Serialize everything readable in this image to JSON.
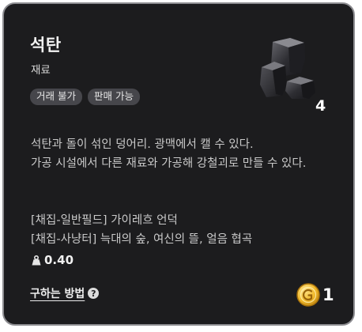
{
  "item": {
    "name": "석탄",
    "category": "재료",
    "tags": [
      "거래 불가",
      "판매 가능"
    ],
    "image_icon": "coal-lumps-icon",
    "quantity": "4",
    "description": [
      "석탄과 돌이 섞인 덩어리. 광맥에서 캘 수 있다.",
      "가공 시설에서 다른 재료와 가공해 강철괴로 만들 수 있다."
    ],
    "sources": [
      "[채집-일반필드] 가이레흐 언덕",
      "[채집-사냥터] 늑대의 숲, 여신의 뜰, 얼음 협곡"
    ],
    "weight": "0.40",
    "weight_icon": "weight-icon"
  },
  "footer": {
    "how_to_obtain_label": "구하는 방법",
    "help_icon": "question-icon",
    "price": "1",
    "currency_icon": "gold-coin-icon"
  },
  "colors": {
    "panel_background": "#1c1c1e",
    "panel_border": "#8d8d91",
    "tag_background": "#46464b",
    "coin_gold": "#f0b82a"
  }
}
